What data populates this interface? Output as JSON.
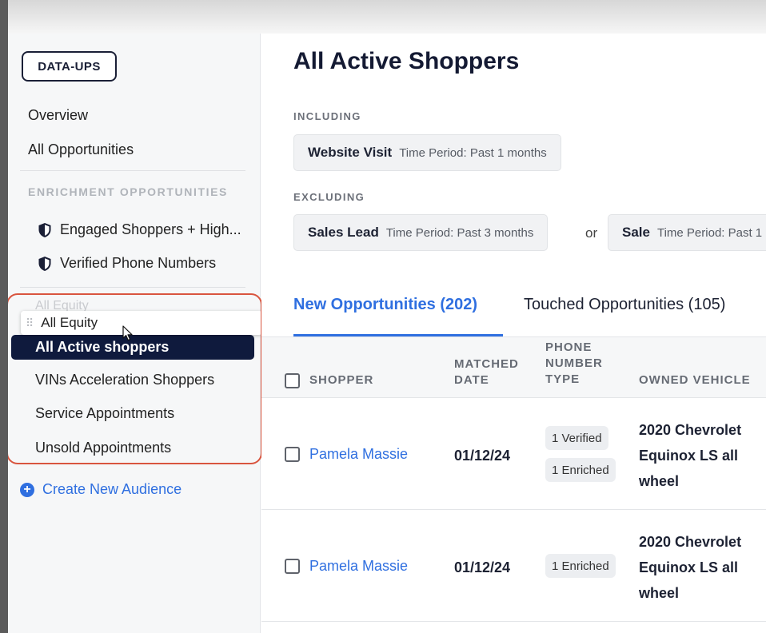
{
  "sidebar": {
    "brand": "DATA-UPS",
    "nav": [
      {
        "label": "Overview"
      },
      {
        "label": "All Opportunities"
      }
    ],
    "section_heading": "ENRICHMENT OPPORTUNITIES",
    "enrichment_items": [
      {
        "label": "Engaged Shoppers + High...",
        "icon": "shield-icon"
      },
      {
        "label": "Verified Phone Numbers",
        "icon": "shield-icon"
      }
    ],
    "ghost_label": "All Equity",
    "dragging_item": {
      "label": "All Equity",
      "icon": "drag-handle-icon"
    },
    "active_item": {
      "label": "All Active shoppers"
    },
    "audience_items": [
      {
        "label": "VINs Acceleration Shoppers"
      },
      {
        "label": "Service Appointments"
      },
      {
        "label": "Unsold Appointments"
      }
    ],
    "create_link": {
      "label": "Create New Audience",
      "icon": "plus-circle-icon"
    }
  },
  "main": {
    "title": "All Active Shoppers",
    "including_label": "INCLUDING",
    "including_filters": [
      {
        "title": "Website Visit",
        "detail": "Time Period: Past 1 months"
      }
    ],
    "excluding_label": "EXCLUDING",
    "excluding_filters": [
      {
        "title": "Sales Lead",
        "detail": "Time Period: Past 3 months"
      },
      {
        "title": "Sale",
        "detail": "Time Period: Past 1"
      }
    ],
    "or_text": "or",
    "tabs": [
      {
        "label": "New Opportunities (202)",
        "active": true
      },
      {
        "label": "Touched Opportunities (105)",
        "active": false
      }
    ],
    "table": {
      "headers": {
        "shopper": "SHOPPER",
        "matched_date": [
          "MATCHED",
          "DATE"
        ],
        "phone_type": [
          "PHONE",
          "NUMBER",
          "TYPE"
        ],
        "owned_vehicle": "OWNED VEHICLE"
      },
      "rows": [
        {
          "shopper": "Pamela Massie",
          "matched_date": "01/12/24",
          "phone_types": [
            "1 Verified",
            "1 Enriched"
          ],
          "vehicle": "2020 Chevrolet Equinox LS all wheel"
        },
        {
          "shopper": "Pamela Massie",
          "matched_date": "01/12/24",
          "phone_types": [
            "1 Enriched"
          ],
          "vehicle": "2020 Chevrolet Equinox LS all wheel"
        }
      ]
    }
  },
  "colors": {
    "accent": "#2f6fe0",
    "active_bg": "#0f1a3d",
    "highlight_outline": "#d9553f"
  }
}
